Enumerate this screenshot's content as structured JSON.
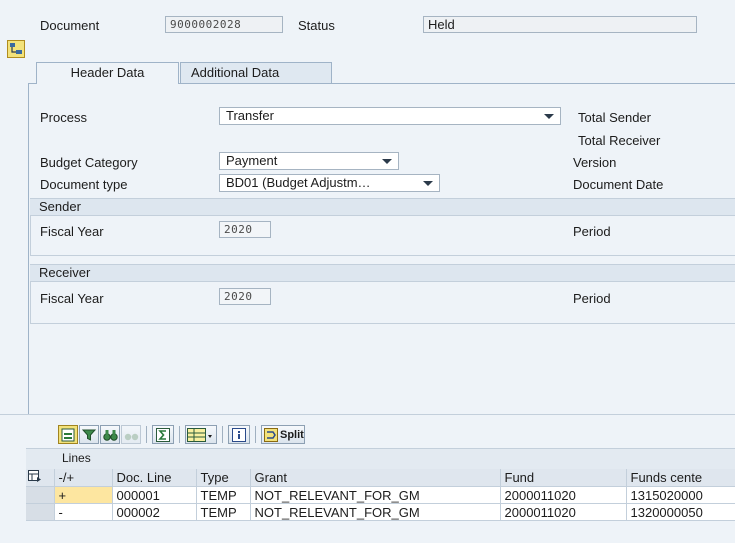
{
  "header": {
    "document_label": "Document",
    "document_value": "9000002028",
    "status_label": "Status",
    "status_value": "Held"
  },
  "tabs": [
    {
      "label": "Header Data",
      "active": true
    },
    {
      "label": "Additional Data",
      "active": false
    }
  ],
  "form": {
    "process_label": "Process",
    "process_value": "Transfer",
    "budget_category_label": "Budget Category",
    "budget_category_value": "Payment",
    "document_type_label": "Document type",
    "document_type_value": "BD01 (Budget Adjustm…",
    "total_sender_label": "Total Sender",
    "total_receiver_label": "Total Receiver",
    "version_label": "Version",
    "document_date_label": "Document Date"
  },
  "sender": {
    "title": "Sender",
    "fiscal_year_label": "Fiscal Year",
    "fiscal_year_value": "2020",
    "period_label": "Period"
  },
  "receiver": {
    "title": "Receiver",
    "fiscal_year_label": "Fiscal Year",
    "fiscal_year_value": "2020",
    "period_label": "Period"
  },
  "toolbar": {
    "split_label": "Split"
  },
  "lines": {
    "title": "Lines",
    "columns": [
      "-/+",
      "Doc. Line",
      "Type",
      "Grant",
      "Fund",
      "Funds cente"
    ],
    "rows": [
      {
        "sign": "+",
        "doc_line": "000001",
        "type": "TEMP",
        "grant": "NOT_RELEVANT_FOR_GM",
        "fund": "2000011020",
        "funds_center": "1315020000"
      },
      {
        "sign": "-",
        "doc_line": "000002",
        "type": "TEMP",
        "grant": "NOT_RELEVANT_FOR_GM",
        "fund": "2000011020",
        "funds_center": "1320000050"
      }
    ]
  },
  "colors": {
    "background": "#eef3f8",
    "section_header": "#dde6ef",
    "highlight_cell": "#fde6a0",
    "border": "#a6b4c2"
  }
}
